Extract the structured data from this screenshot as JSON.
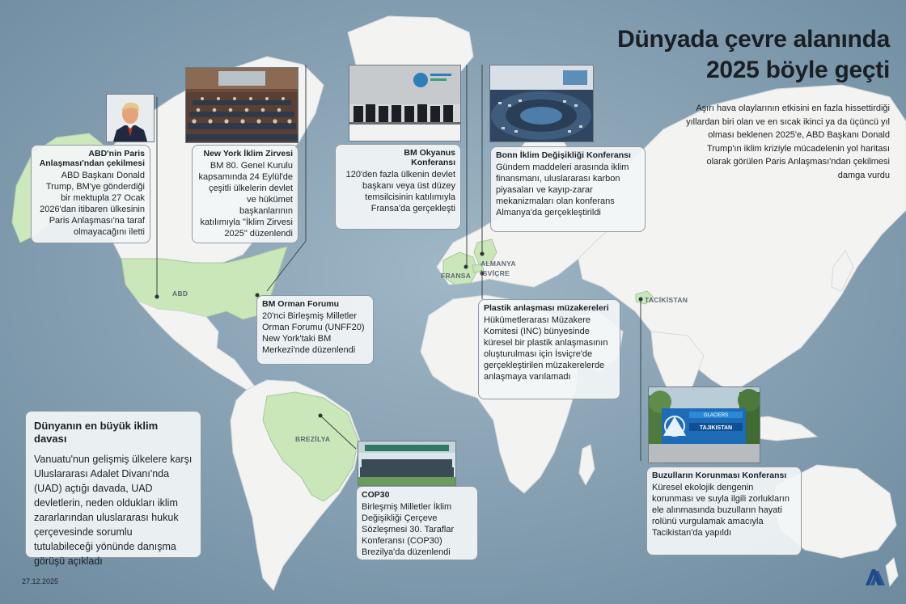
{
  "header": {
    "title_line1": "Dünyada çevre alanında",
    "title_line2": "2025 böyle geçti",
    "subtitle": "Aşırı hava olaylarının etkisini en fazla hissettirdiği yıllardan biri olan ve en sıcak ikinci ya da üçüncü yıl olması beklenen 2025'e, ABD Başkanı Donald Trump'ın iklim kriziyle mücadelenin yol haritası olarak görülen Paris Anlaşması'ndan çekilmesi damga vurdu"
  },
  "countries": {
    "usa": "ABD",
    "france": "FRANSA",
    "germany": "ALMANYA",
    "switzerland": "İSVİÇRE",
    "tajikistan": "TACİKİSTAN",
    "brazil": "BREZİLYA"
  },
  "events": {
    "paris": {
      "title": "ABD'nin Paris Anlaşması'ndan çekilmesi",
      "body": "ABD Başkanı Donald Trump, BM'ye gönderdiği bir mektupla 27 Ocak 2026'dan itibaren ülkesinin Paris Anlaşması'na taraf olmayacağını iletti"
    },
    "ny_summit": {
      "title": "New York İklim Zirvesi",
      "body": "BM 80. Genel Kurulu kapsamında 24 Eylül'de çeşitli ülkelerin devlet ve hükümet başkanlarının katılımıyla \"İklim Zirvesi 2025\" düzenlendi"
    },
    "ocean": {
      "title": "BM Okyanus Konferansı",
      "body": "120'den fazla ülkenin devlet başkanı veya üst düzey temsilcisinin katılımıyla Fransa'da gerçekleşti"
    },
    "bonn": {
      "title": "Bonn İklim Değişikliği Konferansı",
      "body": "Gündem maddeleri arasında iklim finansmanı, uluslararası karbon piyasaları ve kayıp-zarar mekanizmaları olan konferans Almanya'da gerçekleştirildi"
    },
    "forest": {
      "title": "BM Orman Forumu",
      "body": "20'nci Birleşmiş Milletler Orman Forumu (UNFF20) New York'taki BM Merkezi'nde düzenlendi"
    },
    "plastic": {
      "title": "Plastik anlaşması müzakereleri",
      "body": "Hükümetlerarası Müzakere Komitesi (INC) bünyesinde küresel bir plastik anlaşmasının oluşturulması için İsviçre'de gerçekleştirilen müzakerelerde anlaşmaya varılamadı"
    },
    "court": {
      "title": "Dünyanın en büyük iklim davası",
      "body": "Vanuatu'nun gelişmiş ülkelere karşı Uluslararası Adalet Divanı'nda (UAD) açtığı davada, UAD devletlerin, neden oldukları iklim zararlarından uluslararası hukuk çerçevesinde sorumlu tutulabileceği yönünde danışma görüşü açıkladı"
    },
    "cop30": {
      "title": "COP30",
      "body": "Birleşmiş Milletler İklim Değişikliği Çerçeve Sözleşmesi 30. Taraflar Konferansı (COP30) Brezilya'da düzenlendi"
    },
    "glacier": {
      "title": "Buzulların Korunması Konferansı",
      "body": "Küresel ekolojik dengenin korunması ve suyla ilgili zorlukların ele alınmasında buzulların hayati rolünü vurgulamak amacıyla Tacikistan'da yapıldı"
    }
  },
  "photo_sign": {
    "line1": "GLACIERS",
    "line2": "TAJIKISTAN"
  },
  "footer": {
    "date": "27.12.2025",
    "logo": "AA"
  },
  "colors": {
    "ocean": "#7b98ac",
    "land": "#f3f3f1",
    "highlight": "#c9e7b9",
    "card": "#f2f5f6"
  }
}
